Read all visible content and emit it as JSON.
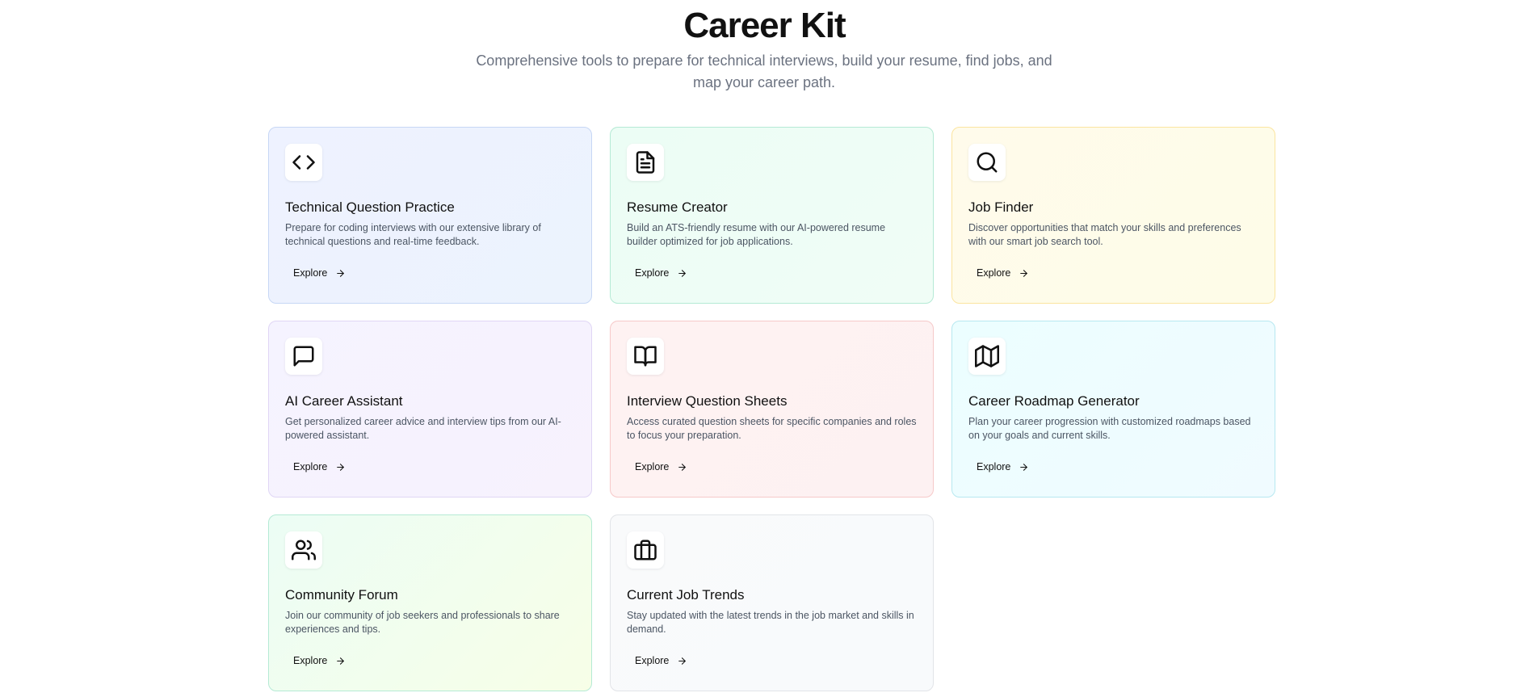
{
  "header": {
    "title": "Career Kit",
    "subtitle": "Comprehensive tools to prepare for technical interviews, build your resume, find jobs, and map your career path."
  },
  "cards": [
    {
      "title": "Technical Question Practice",
      "description": "Prepare for coding interviews with our extensive library of technical questions and real-time feedback.",
      "button_label": "Explore",
      "icon": "code-icon",
      "accent": "#eef2ff"
    },
    {
      "title": "Resume Creator",
      "description": "Build an ATS-friendly resume with our AI-powered resume builder optimized for job applications.",
      "button_label": "Explore",
      "icon": "file-text-icon",
      "accent": "#ecfdf5"
    },
    {
      "title": "Job Finder",
      "description": "Discover opportunities that match your skills and preferences with our smart job search tool.",
      "button_label": "Explore",
      "icon": "search-icon",
      "accent": "#fffbeb"
    },
    {
      "title": "AI Career Assistant",
      "description": "Get personalized career advice and interview tips from our AI-powered assistant.",
      "button_label": "Explore",
      "icon": "message-square-icon",
      "accent": "#f5f3ff"
    },
    {
      "title": "Interview Question Sheets",
      "description": "Access curated question sheets for specific companies and roles to focus your preparation.",
      "button_label": "Explore",
      "icon": "book-open-icon",
      "accent": "#fef2f2"
    },
    {
      "title": "Career Roadmap Generator",
      "description": "Plan your career progression with customized roadmaps based on your goals and current skills.",
      "button_label": "Explore",
      "icon": "map-icon",
      "accent": "#ecfeff"
    },
    {
      "title": "Community Forum",
      "description": "Join our community of job seekers and professionals to share experiences and tips.",
      "button_label": "Explore",
      "icon": "users-icon",
      "accent": "#f0fdf4"
    },
    {
      "title": "Current Job Trends",
      "description": "Stay updated with the latest trends in the job market and skills in demand.",
      "button_label": "Explore",
      "icon": "briefcase-icon",
      "accent": "#f9fafb"
    }
  ]
}
